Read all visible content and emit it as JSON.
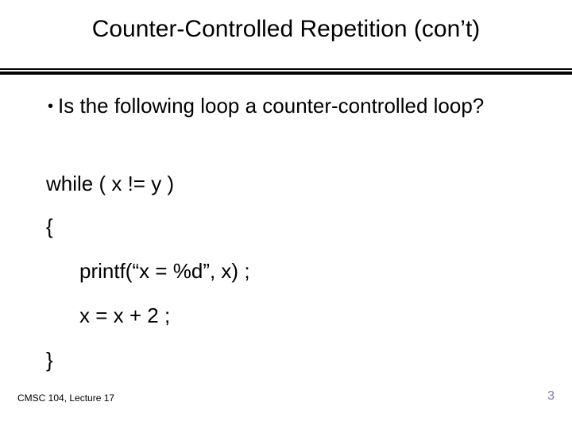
{
  "title": "Counter-Controlled Repetition (con’t)",
  "bullet": {
    "text": "Is the following loop a counter-controlled loop?"
  },
  "code": {
    "while_line": "while ( x != y )",
    "lbrace": "{",
    "printf_line": "printf(“x = %d”, x) ;",
    "incr_line": "x = x + 2 ;",
    "rbrace": "}"
  },
  "footer": {
    "left": "CMSC 104, Lecture 17",
    "right": "3"
  }
}
